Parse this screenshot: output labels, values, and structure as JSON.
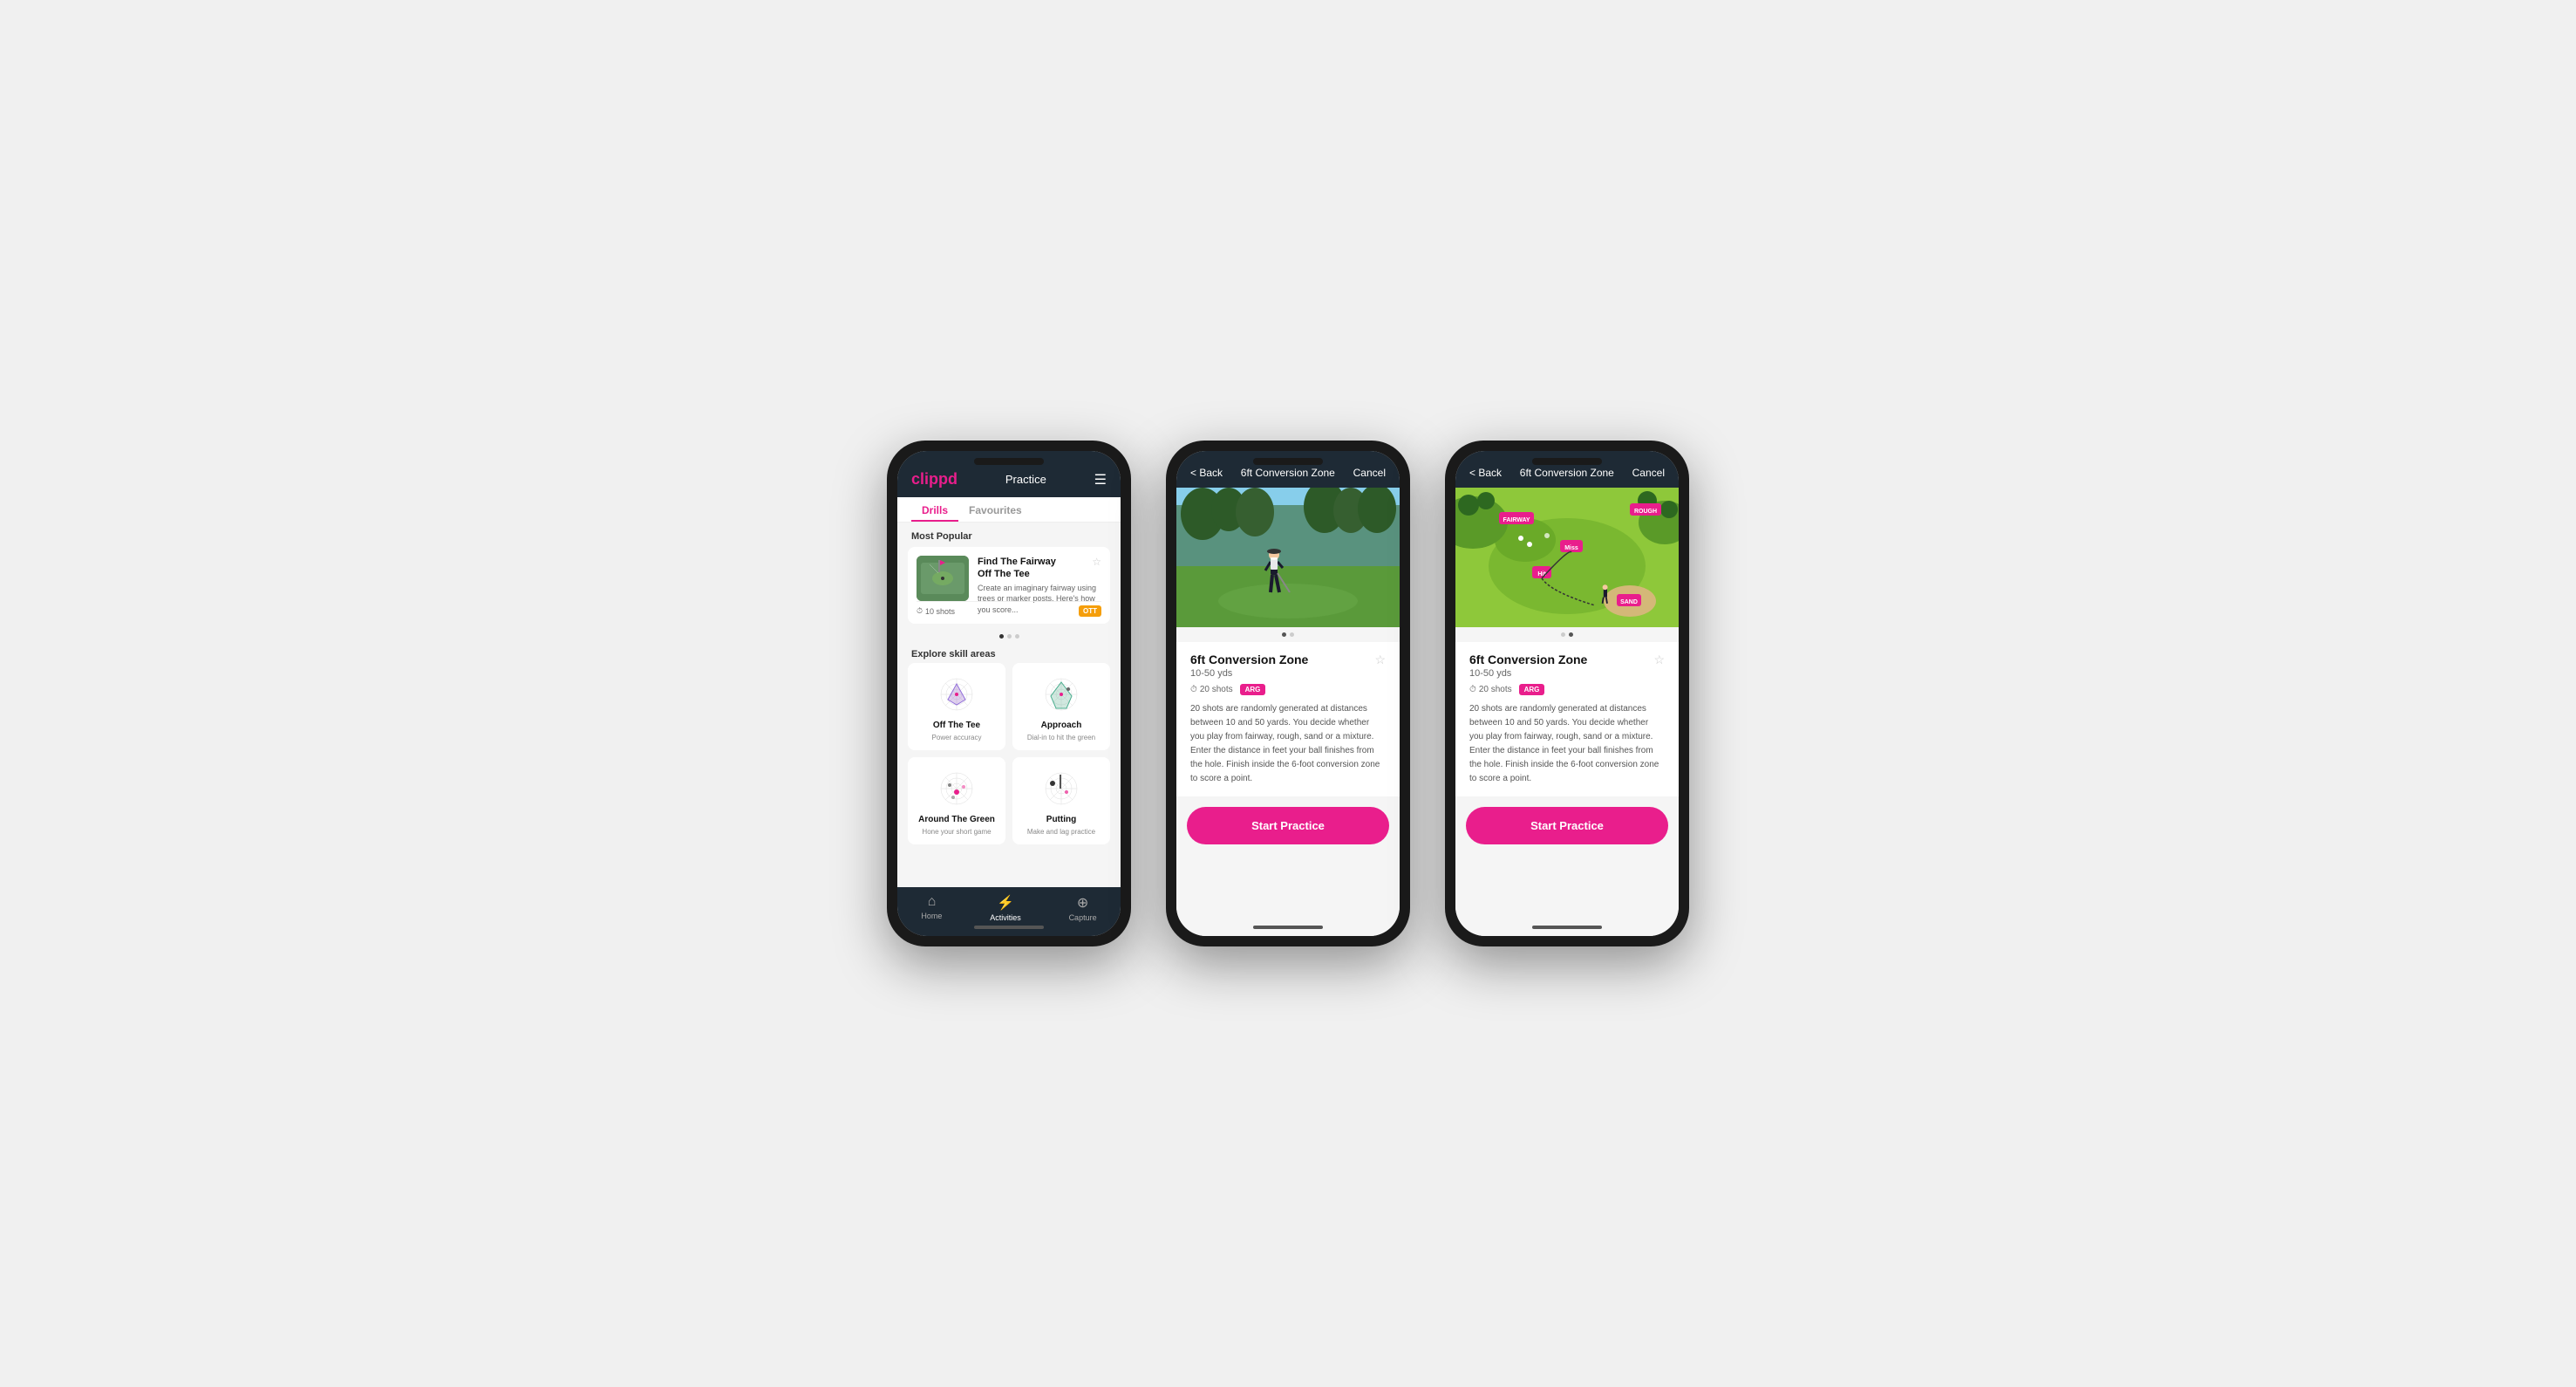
{
  "phones": {
    "phone1": {
      "header": {
        "logo": "clippd",
        "title": "Practice",
        "menu_icon": "☰"
      },
      "tabs": [
        {
          "label": "Drills",
          "active": true
        },
        {
          "label": "Favourites",
          "active": false
        }
      ],
      "most_popular_label": "Most Popular",
      "featured_card": {
        "title": "Find The Fairway",
        "subtitle": "Off The Tee",
        "description": "Create an imaginary fairway using trees or marker posts. Here's how you score...",
        "shots": "10 shots",
        "badge": "OTT"
      },
      "explore_label": "Explore skill areas",
      "skill_areas": [
        {
          "name": "Off The Tee",
          "desc": "Power accuracy"
        },
        {
          "name": "Approach",
          "desc": "Dial-in to hit the green"
        },
        {
          "name": "Around The Green",
          "desc": "Hone your short game"
        },
        {
          "name": "Putting",
          "desc": "Make and lag practice"
        }
      ],
      "bottom_nav": [
        {
          "label": "Home",
          "icon": "⌂",
          "active": false
        },
        {
          "label": "Activities",
          "icon": "⚡",
          "active": true
        },
        {
          "label": "Capture",
          "icon": "⊕",
          "active": false
        }
      ]
    },
    "phone2": {
      "header": {
        "back": "< Back",
        "title": "6ft Conversion Zone",
        "cancel": "Cancel"
      },
      "drill_title": "6ft Conversion Zone",
      "range": "10-50 yds",
      "shots": "20 shots",
      "badge": "ARG",
      "description": "20 shots are randomly generated at distances between 10 and 50 yards. You decide whether you play from fairway, rough, sand or a mixture. Enter the distance in feet your ball finishes from the hole. Finish inside the 6-foot conversion zone to score a point.",
      "start_btn": "Start Practice",
      "image_type": "photo"
    },
    "phone3": {
      "header": {
        "back": "< Back",
        "title": "6ft Conversion Zone",
        "cancel": "Cancel"
      },
      "drill_title": "6ft Conversion Zone",
      "range": "10-50 yds",
      "shots": "20 shots",
      "badge": "ARG",
      "description": "20 shots are randomly generated at distances between 10 and 50 yards. You decide whether you play from fairway, rough, sand or a mixture. Enter the distance in feet your ball finishes from the hole. Finish inside the 6-foot conversion zone to score a point.",
      "start_btn": "Start Practice",
      "image_type": "map"
    }
  }
}
